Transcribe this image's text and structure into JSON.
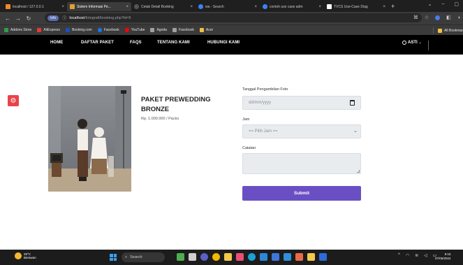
{
  "browser": {
    "tabs": [
      {
        "label": "localhost / 127.0.0.1",
        "icon": "phpmyadmin-icon",
        "color": "#f08a24",
        "active": false
      },
      {
        "label": "Sistem Informasi Pe...",
        "icon": "page-icon",
        "color": "#e0a030",
        "active": true
      },
      {
        "label": "Cetak Detail Booking",
        "icon": "globe-icon",
        "color": "#555555",
        "active": false
      },
      {
        "label": "wa - Search",
        "icon": "search-icon",
        "color": "#3b82f6",
        "active": false
      },
      {
        "label": "contoh use case adm",
        "icon": "search-icon",
        "color": "#3b82f6",
        "active": false
      },
      {
        "label": "TVCS Use-Case Diag",
        "icon": "doc-icon",
        "color": "#ffffff",
        "active": false
      }
    ],
    "new_tab": "+",
    "window_controls": {
      "minimize": "–",
      "maximize": "▢",
      "close": "×"
    },
    "nav": {
      "back": "←",
      "forward": "→",
      "reload": "↻"
    },
    "address": {
      "chip": "Info",
      "host": "localhost",
      "path": "/fotografi/booking.php?id=5"
    },
    "address_icons": [
      "translate-icon",
      "star-icon",
      "extension-icon",
      "sidebar-icon",
      "profile-icon"
    ],
    "bookmarks": [
      {
        "label": "Addons Store",
        "color": "#2e9e4f"
      },
      {
        "label": "AliExpress",
        "color": "#e53935"
      },
      {
        "label": "Booking.com",
        "color": "#1e4fb8"
      },
      {
        "label": "Facebook",
        "color": "#1877f2"
      },
      {
        "label": "YouTube",
        "color": "#ff0000"
      },
      {
        "label": "Agoda",
        "color": "#a0a0a0"
      },
      {
        "label": "Facebook",
        "color": "#a0a0a0"
      },
      {
        "label": "Acer",
        "color": "#f0c040"
      }
    ],
    "all_bookmarks": "All Bookmar"
  },
  "site_nav": {
    "links": [
      "HOME",
      "DAFTAR PAKET",
      "FAQS",
      "TENTANG KAMI",
      "HUBUNGI KAMI"
    ],
    "user": "ASTI"
  },
  "package": {
    "title": "PAKET PREWEDDING BRONZE",
    "price": "Rp. 1.000.000 / Packs",
    "image_icon": "prewedding-photo"
  },
  "form": {
    "date_label": "Tanggal Pengambilan Foto",
    "date_placeholder": "dd/mm/yyyy",
    "time_label": "Jam",
    "time_placeholder": "== Pilih Jam ==",
    "notes_label": "Catatan",
    "submit_label": "Submit"
  },
  "taskbar": {
    "weather_temp": "28°C",
    "weather_desc": "Berawan",
    "search_placeholder": "Search",
    "apps": [
      {
        "name": "widgets-icon",
        "color": "#4cae50"
      },
      {
        "name": "taskview-icon",
        "color": "#cfcfcf"
      },
      {
        "name": "chat-icon",
        "color": "#5b5fc7"
      },
      {
        "name": "chrome-icon",
        "color": "#f2b705"
      },
      {
        "name": "files-icon",
        "color": "#f2c94c"
      },
      {
        "name": "app-icon",
        "color": "#e94e77"
      },
      {
        "name": "edge-icon",
        "color": "#1ba0d8"
      },
      {
        "name": "mail-icon",
        "color": "#2b88d8"
      },
      {
        "name": "store-icon",
        "color": "#3c78d8"
      },
      {
        "name": "calculator-icon",
        "color": "#2f8fd8"
      },
      {
        "name": "photos-icon",
        "color": "#ea6a47"
      },
      {
        "name": "media-icon",
        "color": "#f2c94c"
      },
      {
        "name": "word-icon",
        "color": "#2b6cd8"
      }
    ],
    "time": "9:15",
    "date": "07/05/2024"
  }
}
